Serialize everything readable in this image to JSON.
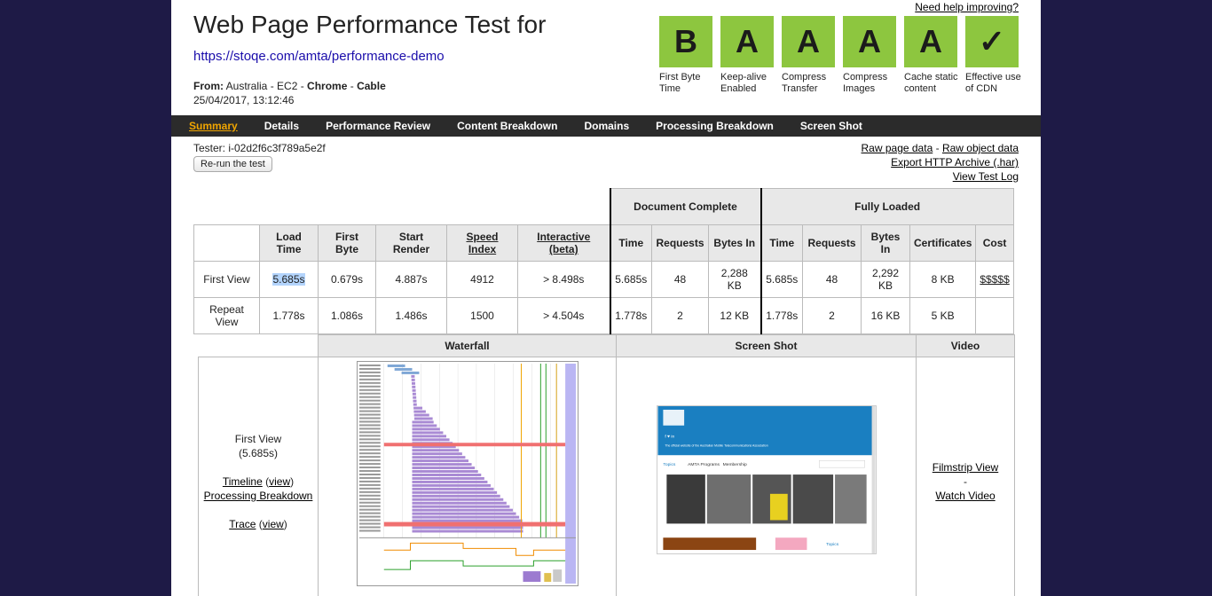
{
  "header": {
    "title": "Web Page Performance Test for",
    "url": "https://stoqe.com/amta/performance-demo",
    "from_label": "From:",
    "from_location": "Australia - EC2 -",
    "browser": "Chrome",
    "separator": "-",
    "connection": "Cable",
    "datetime": "25/04/2017, 13:12:46",
    "help_link": "Need help improving?"
  },
  "grades": [
    {
      "grade": "B",
      "label": "First Byte Time"
    },
    {
      "grade": "A",
      "label": "Keep-alive Enabled"
    },
    {
      "grade": "A",
      "label": "Compress Transfer"
    },
    {
      "grade": "A",
      "label": "Compress Images"
    },
    {
      "grade": "A",
      "label": "Cache static content"
    },
    {
      "grade": "✓",
      "label": "Effective use of CDN"
    }
  ],
  "nav": [
    "Summary",
    "Details",
    "Performance Review",
    "Content Breakdown",
    "Domains",
    "Processing Breakdown",
    "Screen Shot"
  ],
  "tester": "Tester: i-02d2f6c3f789a5e2f",
  "rerun_button": "Re-run the test",
  "links": {
    "raw_page": "Raw page data",
    "dash": "-",
    "raw_object": "Raw object data",
    "export_har": "Export HTTP Archive (.har)",
    "test_log": "View Test Log"
  },
  "results": {
    "group_doc": "Document Complete",
    "group_full": "Fully Loaded",
    "headers": {
      "load_time_1": "Load",
      "load_time_2": "Time",
      "first_byte_1": "First",
      "first_byte_2": "Byte",
      "start_render": "Start Render",
      "speed_index_1": "Speed",
      "speed_index_2": "Index",
      "interactive_1": "Interactive",
      "interactive_2": "(beta)",
      "doc_time": "Time",
      "doc_requests": "Requests",
      "doc_bytes": "Bytes In",
      "full_time": "Time",
      "full_requests": "Requests",
      "full_bytes": "Bytes In",
      "certificates": "Certificates",
      "cost": "Cost"
    },
    "rows": [
      {
        "label": "First View",
        "load": "5.685s",
        "first_byte": "0.679s",
        "start_render": "4.887s",
        "speed_index": "4912",
        "interactive": "> 8.498s",
        "doc_time": "5.685s",
        "doc_requests": "48",
        "doc_bytes_1": "2,288",
        "doc_bytes_2": "KB",
        "full_time": "5.685s",
        "full_requests": "48",
        "full_bytes_1": "2,292",
        "full_bytes_2": "KB",
        "certificates": "8 KB",
        "cost": "$$$$$"
      },
      {
        "label_1": "Repeat",
        "label_2": "View",
        "load": "1.778s",
        "first_byte": "1.086s",
        "start_render": "1.486s",
        "speed_index": "1500",
        "interactive": "> 4.504s",
        "doc_time": "1.778s",
        "doc_requests": "2",
        "doc_bytes": "12 KB",
        "full_time": "1.778s",
        "full_requests": "2",
        "full_bytes": "16 KB",
        "certificates": "5 KB",
        "cost": ""
      }
    ]
  },
  "media": {
    "col_waterfall": "Waterfall",
    "col_screenshot": "Screen Shot",
    "col_video": "Video",
    "first_view": "First View",
    "first_view_time": "(5.685s)",
    "timeline": "Timeline",
    "view": "view",
    "processing_breakdown": "Processing Breakdown",
    "trace": "Trace",
    "filmstrip": "Filmstrip View",
    "video_dash": "-",
    "watch_video": "Watch Video"
  },
  "screenshot": {
    "nav_topics": "Topics",
    "nav_programs": "AMTA Programs",
    "nav_membership": "Membership",
    "topics_label": "Topics",
    "tagline": "The official website of the Australian Mobile Telecommunications Association"
  },
  "colors": {
    "background": "#1e1a46",
    "grade_green": "#8dc63f",
    "nav_bar": "#2b2b2b",
    "nav_active": "#f0a500",
    "site_blue": "#1a7fc1"
  }
}
